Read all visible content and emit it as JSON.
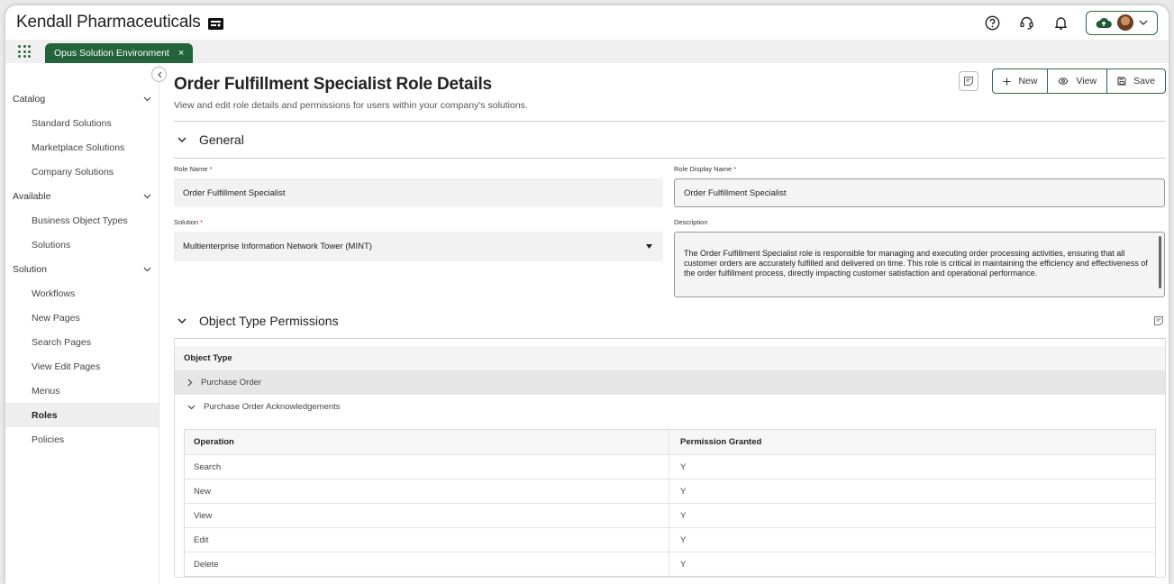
{
  "app": {
    "brand": "Kendall Pharmaceuticals"
  },
  "tabs": [
    {
      "label": "Opus Solution Environment",
      "close": "×"
    }
  ],
  "sidebar": {
    "groups": [
      {
        "label": "Catalog",
        "items": [
          "Standard Solutions",
          "Marketplace Solutions",
          "Company Solutions"
        ]
      },
      {
        "label": "Available",
        "items": [
          "Business Object Types",
          "Solutions"
        ]
      },
      {
        "label": "Solution",
        "items": [
          "Workflows",
          "New Pages",
          "Search Pages",
          "View Edit Pages",
          "Menus",
          "Roles",
          "Policies"
        ]
      }
    ],
    "active": "Roles"
  },
  "page": {
    "title": "Order Fulfillment Specialist Role Details",
    "subtitle": "View and edit role details and permissions for users within your company's solutions."
  },
  "actions": {
    "new": "New",
    "view": "View",
    "save": "Save"
  },
  "general": {
    "heading": "General",
    "role_name_label": "Role Name",
    "role_name": "Order Fulfillment Specialist",
    "display_name_label": "Role Display Name",
    "display_name": "Order Fulfillment Specialist",
    "solution_label": "Solution",
    "solution": "Multienterprise Information Network Tower (MINT)",
    "description_label": "Description",
    "description": "The Order Fulfillment Specialist role is responsible for managing and executing order processing activities, ensuring that all customer orders are accurately fulfilled and delivered on time. This role is critical in maintaining the efficiency and effectiveness of the order fulfillment process, directly impacting customer satisfaction and operational performance.",
    "required_mark": "*"
  },
  "permissions": {
    "heading": "Object Type Permissions",
    "column": "Object Type",
    "objects": [
      "Purchase Order",
      "Purchase Order Acknowledgements"
    ],
    "operations_header": {
      "operation": "Operation",
      "granted": "Permission Granted"
    },
    "operations": [
      {
        "operation": "Search",
        "granted": "Y"
      },
      {
        "operation": "New",
        "granted": "Y"
      },
      {
        "operation": "View",
        "granted": "Y"
      },
      {
        "operation": "Edit",
        "granted": "Y"
      },
      {
        "operation": "Delete",
        "granted": "Y"
      }
    ]
  },
  "colors": {
    "accent": "#2e6b3f",
    "tab": "#24643a",
    "required": "#cc2222"
  }
}
